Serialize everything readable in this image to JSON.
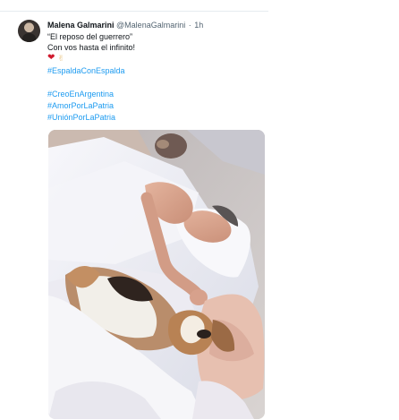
{
  "tweet": {
    "author_name": "Malena Galmarini",
    "handle": "@MalenaGalmarini",
    "separator": "·",
    "time": "1h",
    "lines": [
      "“El reposo del guerrero”",
      "Con vos hasta el infinito!"
    ],
    "emoji": [
      "❤",
      "✌"
    ],
    "hashtags": [
      "#EspaldaConEspalda",
      "#CreoEnArgentina",
      "#AmorPorLaPatria",
      "#UniónPorLaPatria"
    ]
  },
  "photo": {
    "subject": "man sleeping in bed with a beagle"
  }
}
